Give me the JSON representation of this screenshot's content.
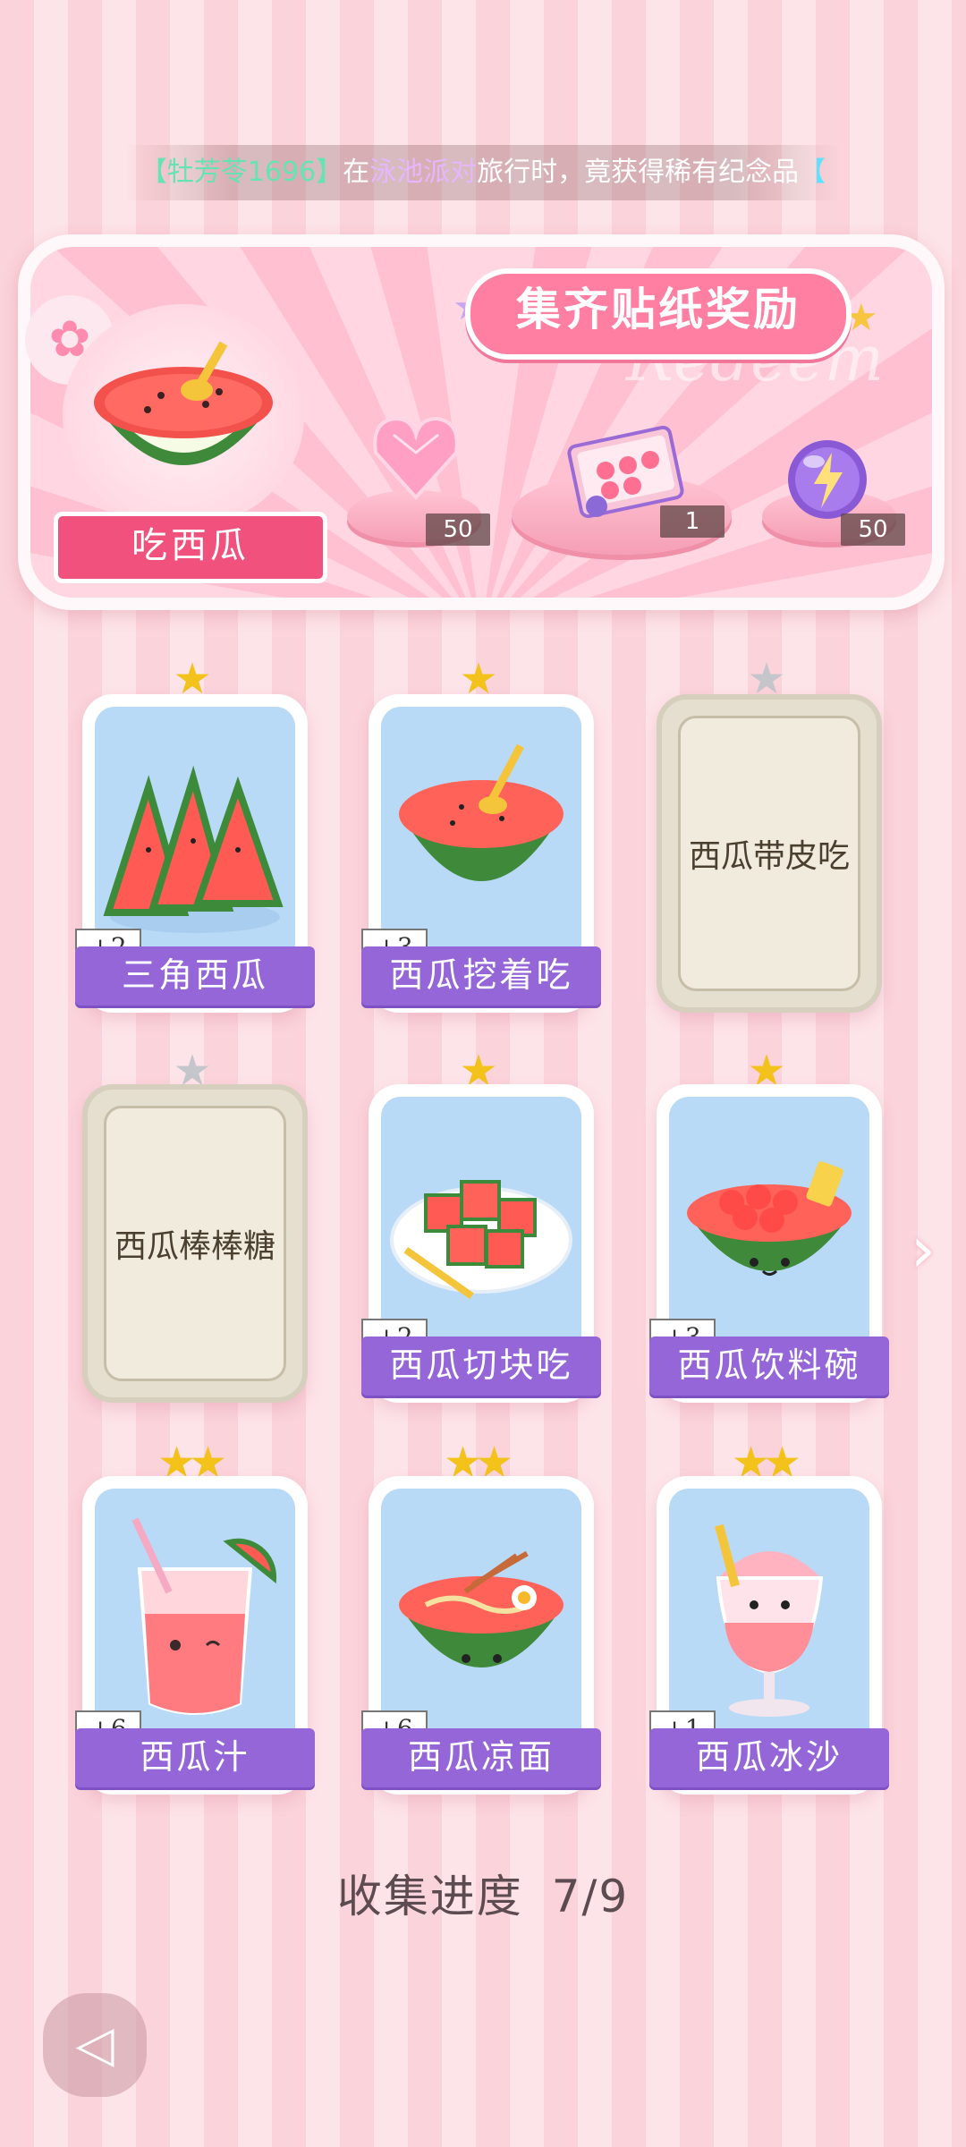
{
  "ticker": {
    "open_bracket": "【",
    "player": "牡芳苓1696",
    "close_bracket": "】",
    "in_text": "在",
    "place": "泳池派对",
    "rest": "旅行时，竟获得稀有纪念品",
    "tail": "【"
  },
  "banner": {
    "title": "集齐贴纸奖励",
    "watermark": "Redeem",
    "item_name": "吃西瓜",
    "rewards": [
      {
        "icon": "pink-heart-gem-icon",
        "qty": "50"
      },
      {
        "icon": "gift-box-icon",
        "qty": "1"
      },
      {
        "icon": "purple-energy-orb-icon",
        "qty": "50"
      }
    ]
  },
  "cards": [
    {
      "name": "三角西瓜",
      "bonus": "+2",
      "stars": 1,
      "star_color": "gold",
      "locked": false
    },
    {
      "name": "西瓜挖着吃",
      "bonus": "+3",
      "stars": 1,
      "star_color": "gold",
      "locked": false
    },
    {
      "name": "西瓜带皮吃",
      "bonus": "",
      "stars": 1,
      "star_color": "silver",
      "locked": true
    },
    {
      "name": "西瓜棒棒糖",
      "bonus": "",
      "stars": 1,
      "star_color": "silver",
      "locked": true
    },
    {
      "name": "西瓜切块吃",
      "bonus": "+2",
      "stars": 1,
      "star_color": "gold",
      "locked": false
    },
    {
      "name": "西瓜饮料碗",
      "bonus": "+3",
      "stars": 1,
      "star_color": "gold",
      "locked": false
    },
    {
      "name": "西瓜汁",
      "bonus": "+6",
      "stars": 2,
      "star_color": "gold",
      "locked": false
    },
    {
      "name": "西瓜凉面",
      "bonus": "+6",
      "stars": 2,
      "star_color": "gold",
      "locked": false
    },
    {
      "name": "西瓜冰沙",
      "bonus": "+1",
      "stars": 2,
      "star_color": "gold",
      "locked": false
    }
  ],
  "progress": {
    "label": "收集进度",
    "value": "7/9"
  },
  "colors": {
    "gold_star": "#f3c21b",
    "silver_star": "#c4c6cc",
    "name_bar": "#9466d8",
    "title_pink": "#ff7fa3"
  }
}
